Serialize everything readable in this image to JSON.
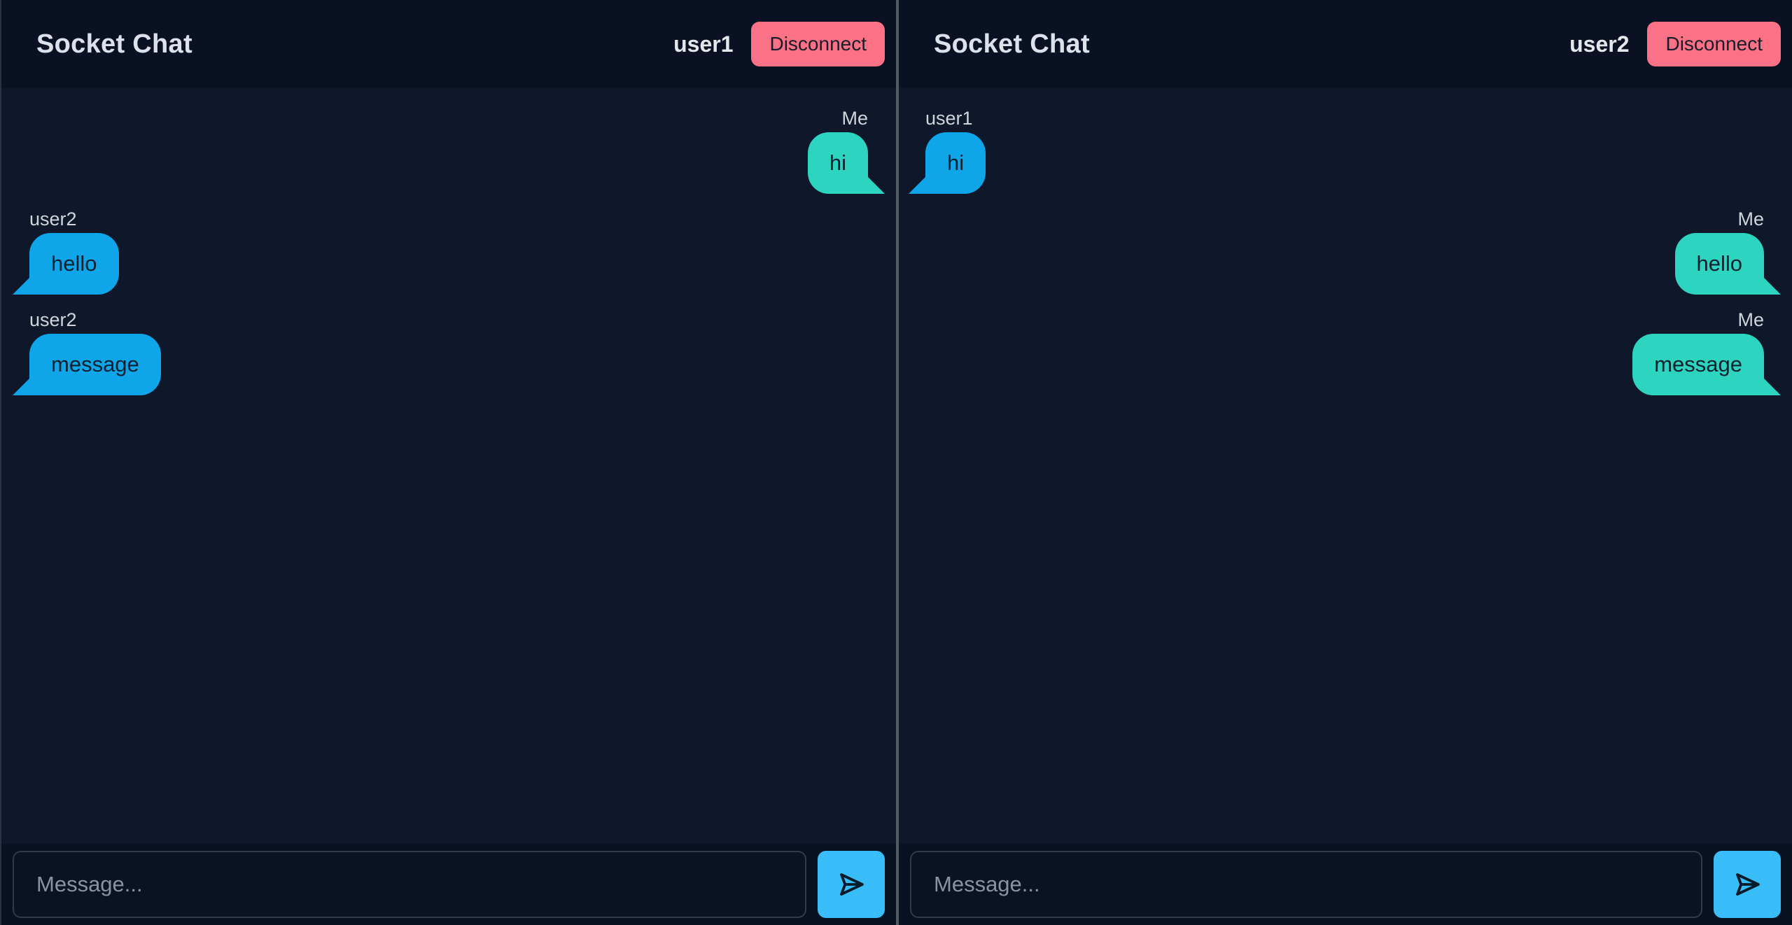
{
  "panes": [
    {
      "title": "Socket Chat",
      "username": "user1",
      "disconnect_label": "Disconnect",
      "input_placeholder": "Message...",
      "messages": [
        {
          "sender": "Me",
          "text": "hi",
          "mine": true
        },
        {
          "sender": "user2",
          "text": "hello",
          "mine": false
        },
        {
          "sender": "user2",
          "text": "message",
          "mine": false
        }
      ]
    },
    {
      "title": "Socket Chat",
      "username": "user2",
      "disconnect_label": "Disconnect",
      "input_placeholder": "Message...",
      "messages": [
        {
          "sender": "user1",
          "text": "hi",
          "mine": false
        },
        {
          "sender": "Me",
          "text": "hello",
          "mine": true
        },
        {
          "sender": "Me",
          "text": "message",
          "mine": true
        }
      ]
    }
  ],
  "icons": {
    "send": "send-icon"
  },
  "colors": {
    "background": "#0f172a",
    "header": "#0a1122",
    "disconnect": "#fb7185",
    "own_bubble": "#2dd4bf",
    "other_bubble": "#0ea5e9",
    "send_button": "#38bdf8"
  }
}
